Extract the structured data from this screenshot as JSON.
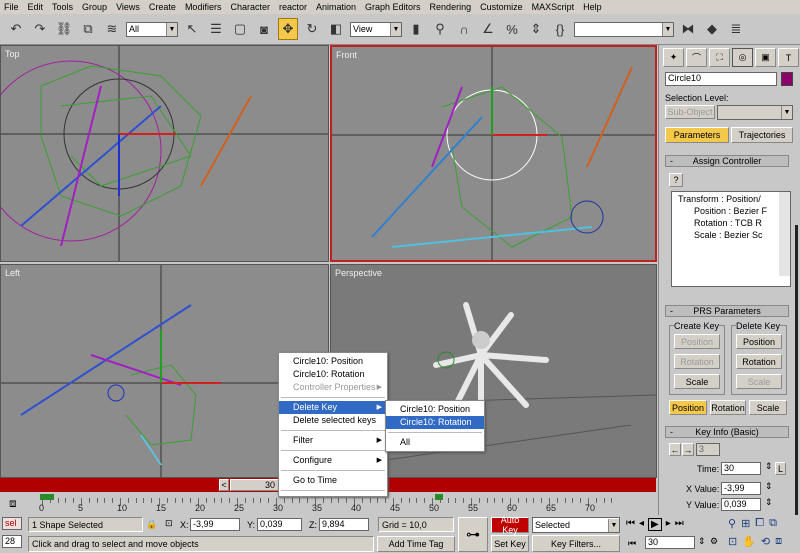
{
  "menu": [
    "File",
    "Edit",
    "Tools",
    "Group",
    "Views",
    "Create",
    "Modifiers",
    "Character",
    "reactor",
    "Animation",
    "Graph Editors",
    "Rendering",
    "Customize",
    "MAXScript",
    "Help"
  ],
  "toolbar": {
    "selection_filter": "All",
    "reference_coord": "View",
    "named_selection": ""
  },
  "viewports": [
    {
      "label": "Top"
    },
    {
      "label": "Front"
    },
    {
      "label": "Left"
    },
    {
      "label": "Perspective"
    }
  ],
  "panel": {
    "object_name": "Circle10",
    "object_color": "#8b006b",
    "selection_level_label": "Selection Level:",
    "sub_object": "Sub-Object",
    "tabs": {
      "parameters": "Parameters",
      "trajectories": "Trajectories"
    },
    "assign_controller": {
      "title": "Assign Controller",
      "help": "?",
      "tree": [
        "Transform : Position/",
        "Position : Bezier F",
        "Rotation : TCB R",
        "Scale : Bezier Sc"
      ]
    },
    "prs": {
      "title": "PRS Parameters",
      "create_key": "Create Key",
      "delete_key": "Delete Key",
      "position": "Position",
      "rotation": "Rotation",
      "scale": "Scale"
    },
    "key_info": {
      "title": "Key Info (Basic)",
      "key_index": "3",
      "time_label": "Time:",
      "time": "30",
      "lock": "L",
      "x_label": "X Value:",
      "x": "-3,99",
      "y_label": "Y Value:",
      "y": "0,039"
    }
  },
  "context_menu": {
    "items": [
      "Circle10: Position",
      "Circle10: Rotation",
      "Controller Properties",
      "Delete Key",
      "Delete selected keys",
      "Filter",
      "Configure",
      "Go to Time"
    ],
    "submenu": [
      "Circle10: Position",
      "Circle10: Rotation",
      "All"
    ]
  },
  "time_slider": {
    "value": "30",
    "prev": "<"
  },
  "ruler": {
    "ticks": [
      "0",
      "5",
      "10",
      "15",
      "20",
      "25",
      "30",
      "35",
      "40",
      "45",
      "50",
      "55",
      "60",
      "65",
      "70"
    ]
  },
  "status": {
    "maxscript": "sel",
    "maxscript2": "28",
    "selected": "1 Shape Selected",
    "x_label": "X:",
    "x": "-3,99",
    "y_label": "Y:",
    "y": "0,039",
    "z_label": "Z:",
    "z": "9,894",
    "grid": "Grid = 10,0",
    "prompt": "Click and drag to select and move objects",
    "add_time_tag": "Add Time Tag",
    "auto_key": "Auto Key",
    "set_key": "Set Key",
    "key_mode": "Selected",
    "key_filters": "Key Filters...",
    "frame": "30"
  },
  "colors": {
    "auto_key": "#c00000",
    "active_border": "#c02020",
    "highlight": "#316ac5",
    "yellow": "#f4c84a"
  }
}
